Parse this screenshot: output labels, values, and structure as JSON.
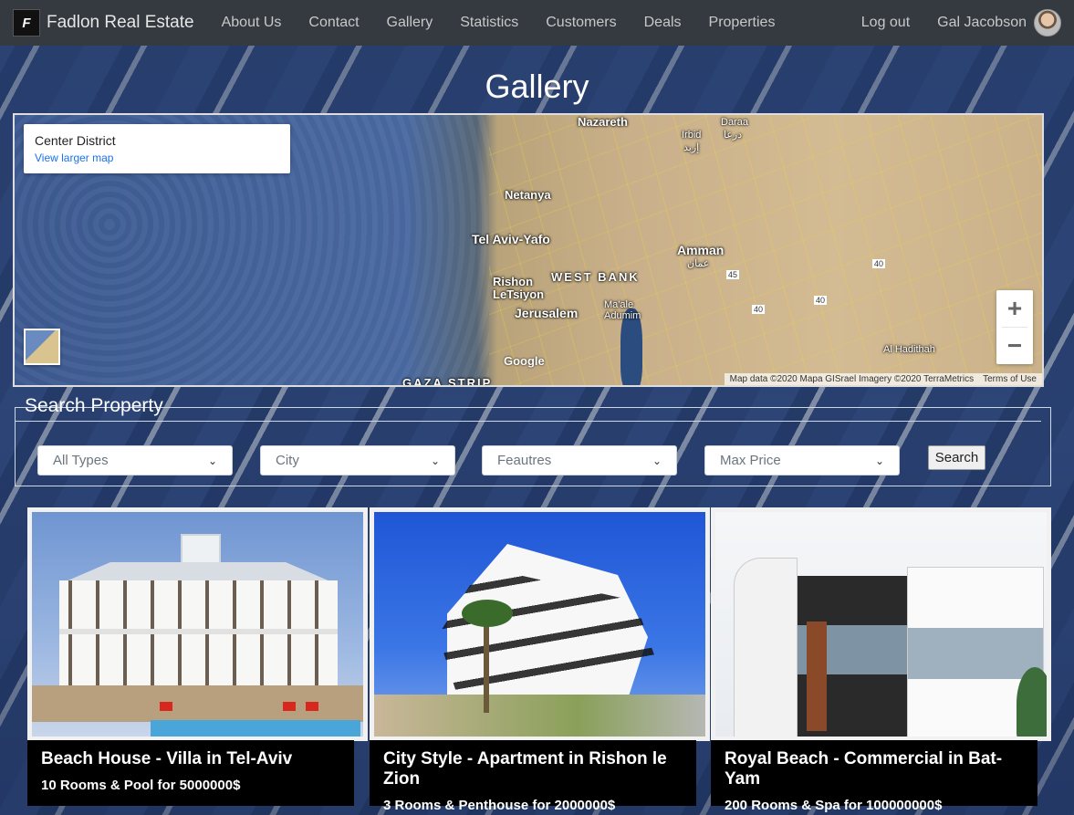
{
  "navbar": {
    "logo_letter": "F",
    "brand": "Fadlon Real Estate",
    "links": [
      "About Us",
      "Contact",
      "Gallery",
      "Statistics",
      "Customers",
      "Deals",
      "Properties"
    ],
    "logout": "Log out",
    "user_name": "Gal Jacobson"
  },
  "page": {
    "title": "Gallery"
  },
  "map": {
    "place_title": "Center District",
    "view_larger": "View larger map",
    "labels": {
      "nazareth": "Nazareth",
      "daraa": "Daraa",
      "daraa_ar": "درعا",
      "irbid": "Irbid",
      "irbid_ar": "إربد",
      "netanya": "Netanya",
      "tel_aviv": "Tel Aviv-Yafo",
      "amman": "Amman",
      "amman_ar": "عمان",
      "rishon": "Rishon LeTsiyon",
      "west_bank": "WEST BANK",
      "jerusalem": "Jerusalem",
      "maale_adumim": "Ma'ale Adumim",
      "gaza": "GAZA STRIP",
      "al_haditha": "Al Hadithah",
      "shield_45": "45",
      "shield_40a": "40",
      "shield_40b": "40",
      "shield_40c": "40"
    },
    "zoom_in": "+",
    "zoom_out": "−",
    "google": "Google",
    "attribution": "Map data ©2020 Mapa GISrael Imagery ©2020 TerraMetrics",
    "terms": "Terms of Use"
  },
  "search": {
    "title": "Search Property",
    "filters": [
      {
        "selected": "All Types"
      },
      {
        "selected": "City"
      },
      {
        "selected": "Feautres"
      },
      {
        "selected": "Max Price"
      }
    ],
    "button": "Search"
  },
  "properties": [
    {
      "title": "Beach House - Villa in Tel-Aviv",
      "details": "10 Rooms & Pool for 5000000$"
    },
    {
      "title": "City Style - Apartment in Rishon le Zion",
      "details": "3 Rooms & Penthouse for 2000000$"
    },
    {
      "title": "Royal Beach - Commercial in Bat-Yam",
      "details": "200 Rooms & Spa for 100000000$"
    }
  ],
  "colors": {
    "navbar_bg": "#343a40",
    "link_color": "#1a73e8",
    "caption_bg": "#000000"
  }
}
